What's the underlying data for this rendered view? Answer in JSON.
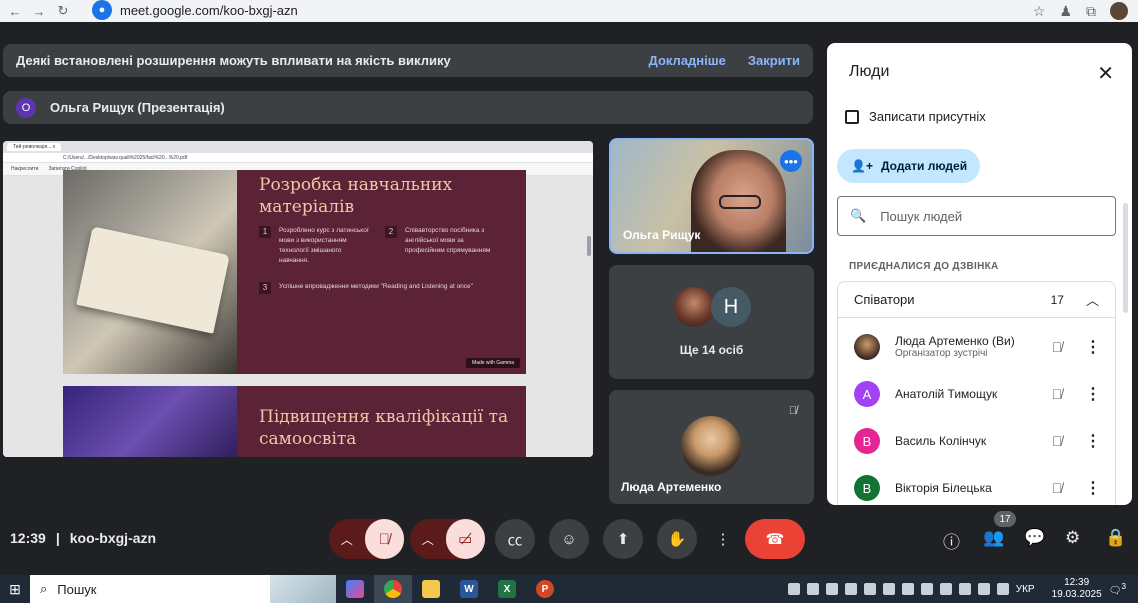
{
  "browser": {
    "url": "meet.google.com/koo-bxgj-azn",
    "icons": [
      "back-icon",
      "forward-icon",
      "reload-icon",
      "bookmark-star-icon",
      "extensions-icon"
    ]
  },
  "banner": {
    "text": "Деякі встановлені розширення можуть впливати на якість виклику",
    "learn_more": "Докладніше",
    "close": "Закрити"
  },
  "presenter": {
    "initial": "О",
    "name": "Ольга Рищук (Презентація)"
  },
  "shared_screen": {
    "tab_title": "Тей-революція... х",
    "address": "C:/Users/.../Desktop/wav.quali%2025/fact%20...%20.pdf",
    "toolbar_items": [
      "Накреслити",
      "Запитати Copilot"
    ],
    "slide1": {
      "title": "Розробка навчальних матеріалів",
      "items": [
        {
          "num": "1",
          "text": "Розроблено курс з латинської мови з використанням технології змішаного навчання."
        },
        {
          "num": "2",
          "text": "Співавторство посібника з англійської мови за професійним спрямуванням"
        },
        {
          "num": "3",
          "text": "Успішне впровадження методики \"Reading and Listening at once\""
        }
      ],
      "badge": "Made with Gamma"
    },
    "slide2": {
      "title": "Підвищення кваліфікації та самоосвіта"
    }
  },
  "tiles": {
    "main_speaker": "Ольга Рищук",
    "more_people": "Ще 14 осіб",
    "h_initial": "H",
    "third": "Люда Артеменко"
  },
  "people_panel": {
    "title": "Люди",
    "record_attendance": "Записати присутніх",
    "add_people": "Додати людей",
    "search_placeholder": "Пошук людей",
    "section": "ПРИЄДНАЛИСЯ ДО ДЗВІНКА",
    "group_label": "Співатори",
    "group_count": "17",
    "people": [
      {
        "name": "Люда Артеменко (Ви)",
        "subtitle": "Організатор зустрічі",
        "initial": "",
        "color": "#3c2822"
      },
      {
        "name": "Анатолій Тимощук",
        "subtitle": "",
        "initial": "А",
        "color": "#a142f4"
      },
      {
        "name": "Василь Колінчук",
        "subtitle": "",
        "initial": "В",
        "color": "#e52592"
      },
      {
        "name": "Вікторія Білецька",
        "subtitle": "",
        "initial": "В",
        "color": "#137333"
      }
    ]
  },
  "bottom_bar": {
    "time": "12:39",
    "separator": "|",
    "meeting_code": "koo-bxgj-azn",
    "people_badge": "17"
  },
  "taskbar": {
    "search": "Пошук",
    "lang": "УКР",
    "time": "12:39",
    "date": "19.03.2025",
    "notifications": "3"
  }
}
